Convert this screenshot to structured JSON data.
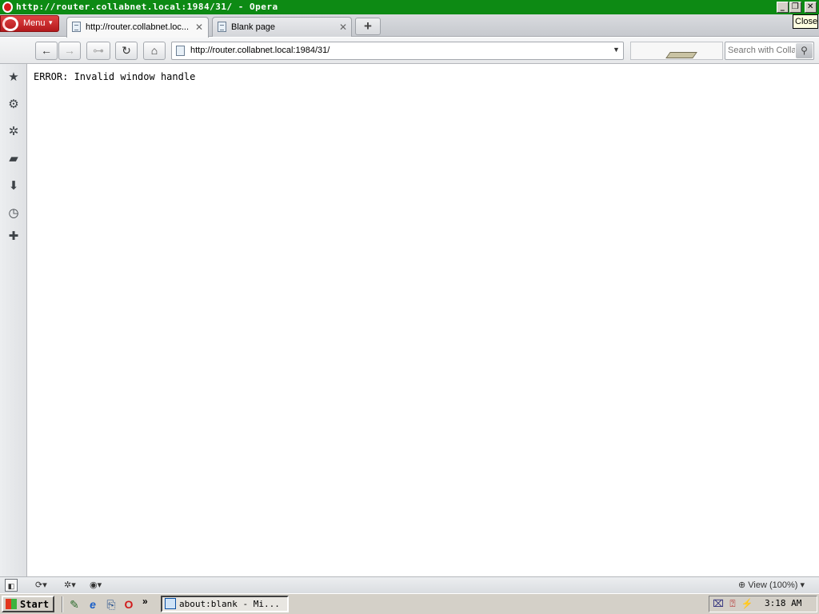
{
  "window": {
    "title": "http://router.collabnet.local:1984/31/ - Opera",
    "minimize_label": "_",
    "maximize_label": "❐",
    "close_label": "✕",
    "tooltip": "Close"
  },
  "menu": {
    "label": "Menu",
    "chevron": "▾"
  },
  "tabs": [
    {
      "label": "http://router.collabnet.loc...",
      "close": "✕",
      "active": true
    },
    {
      "label": "Blank page",
      "close": "✕",
      "active": false
    }
  ],
  "new_tab_label": "+",
  "toolbar": {
    "back": "←",
    "forward": "→",
    "key": "⊶",
    "reload": "↻",
    "home": "⌂",
    "address": "http://router.collabnet.local:1984/31/",
    "address_dropdown": "▼",
    "search_placeholder": "Search with Collabnet",
    "search_glyph": "⚲"
  },
  "sidebar": {
    "items": [
      {
        "name": "bookmarks-icon",
        "glyph": "★"
      },
      {
        "name": "extensions-icon",
        "glyph": "⚙"
      },
      {
        "name": "unite-icon",
        "glyph": "✲"
      },
      {
        "name": "notes-icon",
        "glyph": "▰"
      },
      {
        "name": "downloads-icon",
        "glyph": "⬇"
      },
      {
        "name": "history-icon",
        "glyph": "◷"
      },
      {
        "name": "add-panel-icon",
        "glyph": "✚"
      }
    ]
  },
  "page": {
    "text": "ERROR: Invalid window handle"
  },
  "statusbar": {
    "panel_toggle": "◧",
    "sync": "⟳▾",
    "unite": "✲▾",
    "turbo": "◉▾",
    "view_zoom": "⊕ View (100%) ▾"
  },
  "taskbar": {
    "start_label": "Start",
    "quick_launch": [
      "✎",
      "e",
      "⎘",
      "O"
    ],
    "chevron": "»",
    "task_button": "about:blank - Mi...",
    "tray_icons": [
      "⌧",
      "⍰",
      "⚡"
    ],
    "clock": "3:18 AM"
  },
  "colors": {
    "titlebar": "#0d8a14",
    "menu_button": "#c11e21",
    "tooltip_bg": "#ffffe1",
    "taskbar": "#d4d0c8"
  }
}
